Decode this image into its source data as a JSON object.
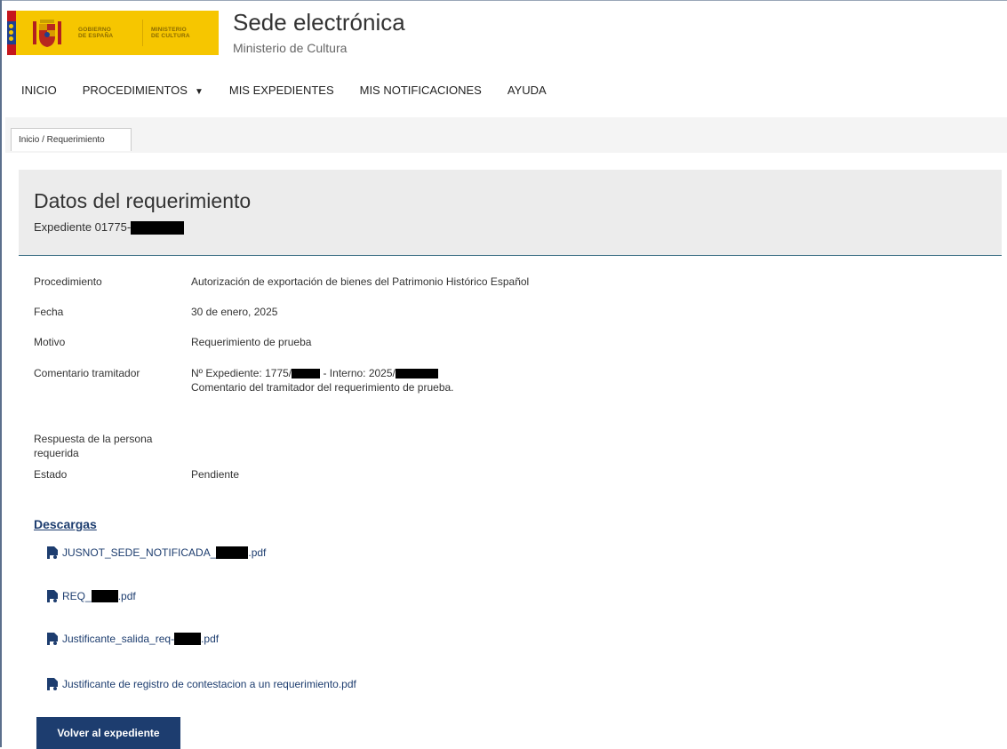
{
  "header": {
    "logo_text_1": "GOBIERNO\nDE ESPAÑA",
    "logo_text_2": "MINISTERIO\nDE CULTURA",
    "title": "Sede electrónica",
    "subtitle": "Ministerio de Cultura"
  },
  "nav": {
    "items": [
      {
        "label": "INICIO"
      },
      {
        "label": "PROCEDIMIENTOS"
      },
      {
        "label": "MIS EXPEDIENTES"
      },
      {
        "label": "MIS NOTIFICACIONES"
      },
      {
        "label": "AYUDA"
      }
    ],
    "dropdown_icon": "caret-down-icon"
  },
  "breadcrumb": "Inicio / Requerimiento",
  "panel": {
    "title": "Datos del requerimiento",
    "expediente_prefix": "Expediente 01775-"
  },
  "details": {
    "procedimiento_label": "Procedimiento",
    "procedimiento_value": "Autorización de exportación de bienes del Patrimonio Histórico Español",
    "fecha_label": "Fecha",
    "fecha_value": "30 de enero, 2025",
    "motivo_label": "Motivo",
    "motivo_value": "Requerimiento de prueba",
    "comentario_label": "Comentario tramitador",
    "comentario_line1_a": "Nº Expediente: 1775/",
    "comentario_line1_b": " - Interno: 2025/",
    "comentario_line2": "Comentario del tramitador del requerimiento de prueba.",
    "respuesta_label": "Respuesta de la persona requerida",
    "estado_label": "Estado",
    "estado_value": "Pendiente"
  },
  "downloads": {
    "title": "Descargas",
    "file_icon": "pdf-file-icon",
    "files": [
      {
        "prefix": "JUSNOT_SEDE_NOTIFICADA_",
        "suffix": ".pdf"
      },
      {
        "prefix": "REQ_",
        "suffix": ".pdf"
      },
      {
        "prefix": "Justificante_salida_req-",
        "suffix": ".pdf"
      },
      {
        "prefix": "Justificante de registro de contestacion a un requerimiento.pdf",
        "suffix": ""
      }
    ]
  },
  "button_label": "Volver al expediente",
  "colors": {
    "brand_blue": "#1d3d6f",
    "logo_yellow": "#f6c600",
    "panel_gray": "#ececec",
    "accent_line": "#3b6f84"
  }
}
